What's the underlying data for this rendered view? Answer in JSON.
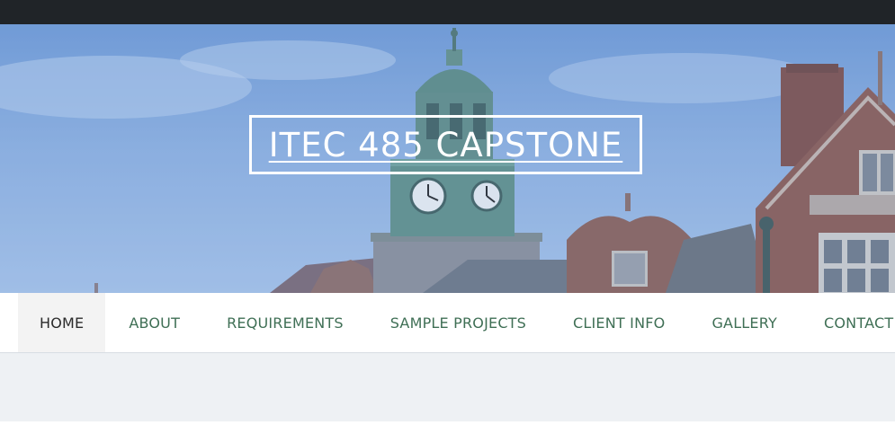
{
  "header": {
    "site_title": "ITEC 485 CAPSTONE"
  },
  "nav": {
    "items": [
      {
        "label": "HOME",
        "active": true
      },
      {
        "label": "ABOUT"
      },
      {
        "label": "REQUIREMENTS"
      },
      {
        "label": "SAMPLE PROJECTS"
      },
      {
        "label": "CLIENT INFO"
      },
      {
        "label": "GALLERY"
      },
      {
        "label": "CONTACT"
      }
    ]
  },
  "colors": {
    "topbar": "#202428",
    "nav_text": "#3f6f55",
    "nav_active_bg": "#f3f3f3",
    "content_band": "#eef1f4"
  },
  "hero": {
    "image": "campus-clocktower-photo"
  }
}
